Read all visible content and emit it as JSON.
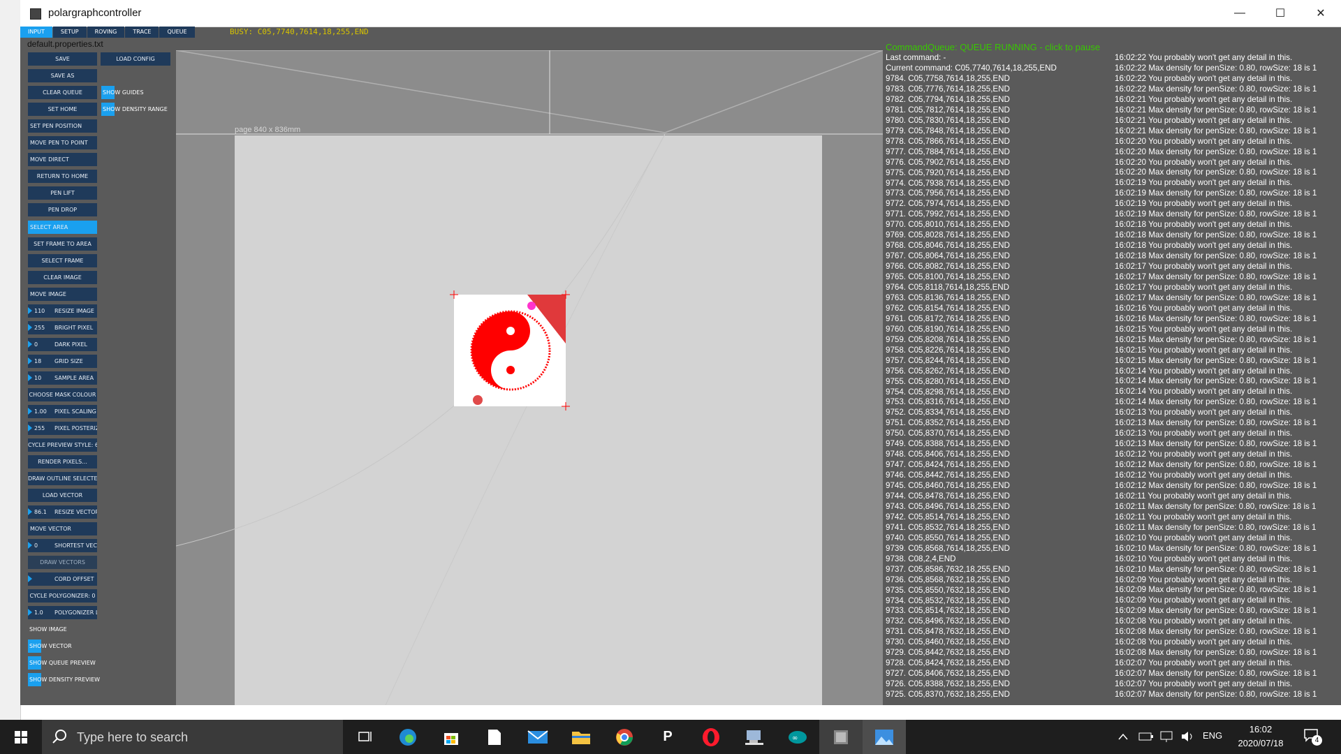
{
  "window": {
    "title": "polargraphcontroller"
  },
  "tabs": [
    "INPUT",
    "SETUP",
    "ROVING",
    "TRACE",
    "QUEUE"
  ],
  "busy_text": "BUSY: C05,7740,7614,18,255,END",
  "properties_file": "default.properties.txt",
  "buttons": {
    "save": "SAVE",
    "load_config": "LOAD CONFIG",
    "save_as": "SAVE AS",
    "clear_queue": "CLEAR QUEUE",
    "show_guides": "SHOW GUIDES",
    "set_home": "SET HOME",
    "show_density_range": "SHOW DENSITY RANGE",
    "set_pen_position": "SET PEN POSITION",
    "move_pen_to_point": "MOVE PEN TO POINT",
    "move_direct": "MOVE DIRECT",
    "return_to_home": "RETURN TO HOME",
    "pen_lift": "PEN LIFT",
    "pen_drop": "PEN DROP",
    "select_area": "SELECT AREA",
    "set_frame_to_area": "SET FRAME TO AREA",
    "select_frame": "SELECT FRAME",
    "clear_image": "CLEAR IMAGE",
    "move_image": "MOVE IMAGE",
    "choose_mask_colour": "CHOOSE MASK COLOUR",
    "cycle_preview_style": "CYCLE PREVIEW STYLE: 6",
    "render_pixels": "RENDER PIXELS...",
    "draw_outline_selected": "DRAW OUTLINE SELECTED",
    "load_vector": "LOAD VECTOR",
    "move_vector": "MOVE VECTOR",
    "draw_vectors": "DRAW VECTORS",
    "cycle_polygonizer": "CYCLE POLYGONIZER: 0",
    "show_image": "SHOW IMAGE",
    "show_vector": "SHOW VECTOR",
    "show_queue_preview": "SHOW QUEUE PREVIEW",
    "show_density_preview": "SHOW DENSITY PREVIEW"
  },
  "numeric": {
    "resize_image": {
      "value": "110",
      "label": "RESIZE IMAGE"
    },
    "bright_pixel": {
      "value": "255",
      "label": "BRIGHT PIXEL"
    },
    "dark_pixel": {
      "value": "0",
      "label": "DARK PIXEL"
    },
    "grid_size": {
      "value": "18",
      "label": "GRID SIZE"
    },
    "sample_area": {
      "value": "10",
      "label": "SAMPLE AREA"
    },
    "pixel_scaling": {
      "value": "1.00",
      "label": "PIXEL SCALING"
    },
    "pixel_posterize": {
      "value": "255",
      "label": "PIXEL POSTERIZE"
    },
    "resize_vector": {
      "value": "86.1",
      "label": "RESIZE VECTOR"
    },
    "shortest_vector": {
      "value": "0",
      "label": "SHORTEST VECTOR"
    },
    "cord_offset": {
      "value": "",
      "label": "CORD OFFSET"
    },
    "polygonizer_length": {
      "value": "1.0",
      "label": "POLYGONIZER LENGTH"
    }
  },
  "canvas": {
    "page_label": "page 840 x 836mm"
  },
  "log": {
    "header": "CommandQueue: QUEUE RUNNING - click to pause",
    "last_command": "Last command: -",
    "current_command": "Current command: C05,7740,7614,18,255,END",
    "queue": [
      "9784. C05,7758,7614,18,255,END",
      "9783. C05,7776,7614,18,255,END",
      "9782. C05,7794,7614,18,255,END",
      "9781. C05,7812,7614,18,255,END",
      "9780. C05,7830,7614,18,255,END",
      "9779. C05,7848,7614,18,255,END",
      "9778. C05,7866,7614,18,255,END",
      "9777. C05,7884,7614,18,255,END",
      "9776. C05,7902,7614,18,255,END",
      "9775. C05,7920,7614,18,255,END",
      "9774. C05,7938,7614,18,255,END",
      "9773. C05,7956,7614,18,255,END",
      "9772. C05,7974,7614,18,255,END",
      "9771. C05,7992,7614,18,255,END",
      "9770. C05,8010,7614,18,255,END",
      "9769. C05,8028,7614,18,255,END",
      "9768. C05,8046,7614,18,255,END",
      "9767. C05,8064,7614,18,255,END",
      "9766. C05,8082,7614,18,255,END",
      "9765. C05,8100,7614,18,255,END",
      "9764. C05,8118,7614,18,255,END",
      "9763. C05,8136,7614,18,255,END",
      "9762. C05,8154,7614,18,255,END",
      "9761. C05,8172,7614,18,255,END",
      "9760. C05,8190,7614,18,255,END",
      "9759. C05,8208,7614,18,255,END",
      "9758. C05,8226,7614,18,255,END",
      "9757. C05,8244,7614,18,255,END",
      "9756. C05,8262,7614,18,255,END",
      "9755. C05,8280,7614,18,255,END",
      "9754. C05,8298,7614,18,255,END",
      "9753. C05,8316,7614,18,255,END",
      "9752. C05,8334,7614,18,255,END",
      "9751. C05,8352,7614,18,255,END",
      "9750. C05,8370,7614,18,255,END",
      "9749. C05,8388,7614,18,255,END",
      "9748. C05,8406,7614,18,255,END",
      "9747. C05,8424,7614,18,255,END",
      "9746. C05,8442,7614,18,255,END",
      "9745. C05,8460,7614,18,255,END",
      "9744. C05,8478,7614,18,255,END",
      "9743. C05,8496,7614,18,255,END",
      "9742. C05,8514,7614,18,255,END",
      "9741. C05,8532,7614,18,255,END",
      "9740. C05,8550,7614,18,255,END",
      "9739. C05,8568,7614,18,255,END",
      "9738. C08,2,4,END",
      "9737. C05,8586,7632,18,255,END",
      "9736. C05,8568,7632,18,255,END",
      "9735. C05,8550,7632,18,255,END",
      "9734. C05,8532,7632,18,255,END",
      "9733. C05,8514,7632,18,255,END",
      "9732. C05,8496,7632,18,255,END",
      "9731. C05,8478,7632,18,255,END",
      "9730. C05,8460,7632,18,255,END",
      "9729. C05,8442,7632,18,255,END",
      "9728. C05,8424,7632,18,255,END",
      "9727. C05,8406,7632,18,255,END",
      "9726. C05,8388,7632,18,255,END",
      "9725. C05,8370,7632,18,255,END"
    ],
    "messages": [
      "16:02:22 You probably won't get any detail in this.",
      "16:02:22 Max density for penSize: 0.80, rowSize: 18 is 1",
      "16:02:22 You probably won't get any detail in this.",
      "16:02:22 Max density for penSize: 0.80, rowSize: 18 is 1",
      "16:02:21 You probably won't get any detail in this.",
      "16:02:21 Max density for penSize: 0.80, rowSize: 18 is 1",
      "16:02:21 You probably won't get any detail in this.",
      "16:02:21 Max density for penSize: 0.80, rowSize: 18 is 1",
      "16:02:20 You probably won't get any detail in this.",
      "16:02:20 Max density for penSize: 0.80, rowSize: 18 is 1",
      "16:02:20 You probably won't get any detail in this.",
      "16:02:20 Max density for penSize: 0.80, rowSize: 18 is 1",
      "16:02:19 You probably won't get any detail in this.",
      "16:02:19 Max density for penSize: 0.80, rowSize: 18 is 1",
      "16:02:19 You probably won't get any detail in this.",
      "16:02:19 Max density for penSize: 0.80, rowSize: 18 is 1",
      "16:02:18 You probably won't get any detail in this.",
      "16:02:18 Max density for penSize: 0.80, rowSize: 18 is 1",
      "16:02:18 You probably won't get any detail in this.",
      "16:02:18 Max density for penSize: 0.80, rowSize: 18 is 1",
      "16:02:17 You probably won't get any detail in this.",
      "16:02:17 Max density for penSize: 0.80, rowSize: 18 is 1",
      "16:02:17 You probably won't get any detail in this.",
      "16:02:17 Max density for penSize: 0.80, rowSize: 18 is 1",
      "16:02:16 You probably won't get any detail in this.",
      "16:02:16 Max density for penSize: 0.80, rowSize: 18 is 1",
      "16:02:15 You probably won't get any detail in this.",
      "16:02:15 Max density for penSize: 0.80, rowSize: 18 is 1",
      "16:02:15 You probably won't get any detail in this.",
      "16:02:15 Max density for penSize: 0.80, rowSize: 18 is 1",
      "16:02:14 You probably won't get any detail in this.",
      "16:02:14 Max density for penSize: 0.80, rowSize: 18 is 1",
      "16:02:14 You probably won't get any detail in this.",
      "16:02:14 Max density for penSize: 0.80, rowSize: 18 is 1",
      "16:02:13 You probably won't get any detail in this.",
      "16:02:13 Max density for penSize: 0.80, rowSize: 18 is 1",
      "16:02:13 You probably won't get any detail in this.",
      "16:02:13 Max density for penSize: 0.80, rowSize: 18 is 1",
      "16:02:12 You probably won't get any detail in this.",
      "16:02:12 Max density for penSize: 0.80, rowSize: 18 is 1",
      "16:02:12 You probably won't get any detail in this.",
      "16:02:12 Max density for penSize: 0.80, rowSize: 18 is 1",
      "16:02:11 You probably won't get any detail in this.",
      "16:02:11 Max density for penSize: 0.80, rowSize: 18 is 1",
      "16:02:11 You probably won't get any detail in this.",
      "16:02:11 Max density for penSize: 0.80, rowSize: 18 is 1",
      "16:02:10 You probably won't get any detail in this.",
      "16:02:10 Max density for penSize: 0.80, rowSize: 18 is 1",
      "16:02:10 You probably won't get any detail in this.",
      "16:02:10 Max density for penSize: 0.80, rowSize: 18 is 1",
      "16:02:09 You probably won't get any detail in this.",
      "16:02:09 Max density for penSize: 0.80, rowSize: 18 is 1",
      "16:02:09 You probably won't get any detail in this.",
      "16:02:09 Max density for penSize: 0.80, rowSize: 18 is 1",
      "16:02:08 You probably won't get any detail in this.",
      "16:02:08 Max density for penSize: 0.80, rowSize: 18 is 1",
      "16:02:08 You probably won't get any detail in this.",
      "16:02:08 Max density for penSize: 0.80, rowSize: 18 is 1",
      "16:02:07 You probably won't get any detail in this.",
      "16:02:07 Max density for penSize: 0.80, rowSize: 18 is 1",
      "16:02:07 You probably won't get any detail in this.",
      "16:02:07 Max density for penSize: 0.80, rowSize: 18 is 1"
    ]
  },
  "taskbar": {
    "search_placeholder": "Type here to search",
    "language": "ENG",
    "time": "16:02",
    "date": "2020/07/18",
    "notification_count": "4"
  },
  "colors": {
    "button_bg": "#1f3a5a",
    "active_blue": "#1aa0ef",
    "busy_yellow": "#d8c400",
    "queue_green": "#38c800",
    "image_red": "#ff0000"
  }
}
